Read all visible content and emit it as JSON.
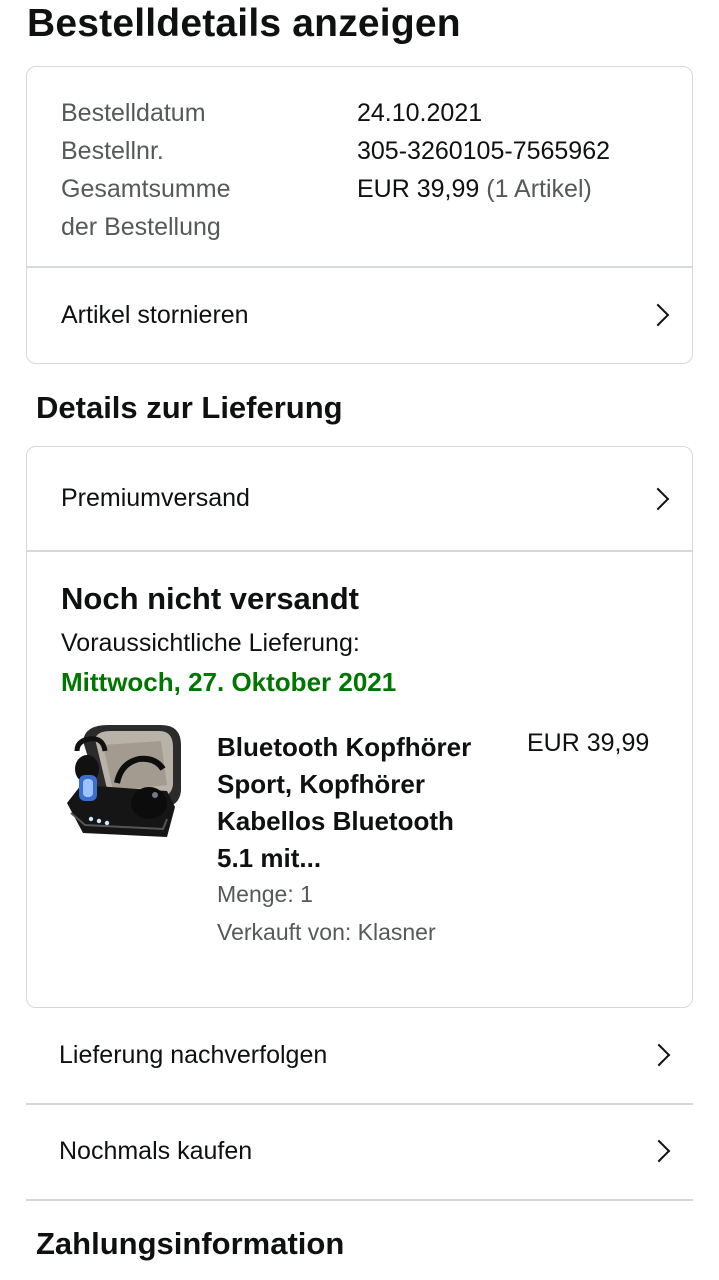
{
  "page": {
    "title": "Bestelldetails anzeigen"
  },
  "order_summary": {
    "date_label": "Bestelldatum",
    "date_value": "24.10.2021",
    "number_label": "Bestellnr.",
    "number_value": "305-3260105-7565962",
    "total_label_line1": "Gesamtsumme",
    "total_label_line2": "der Bestellung",
    "total_value": "EUR 39,99",
    "total_items": "(1 Artikel)",
    "cancel_label": "Artikel stornieren"
  },
  "delivery": {
    "heading": "Details zur Lieferung",
    "shipping_method": "Premiumversand",
    "status": "Noch nicht versandt",
    "eta_label": "Voraussichtliche Lieferung:",
    "eta_date": "Mittwoch, 27. Oktober 2021",
    "eta_color": "#007600",
    "item": {
      "image_icon": "earbuds-product-image",
      "title_lines": [
        "Bluetooth Kopfhörer",
        "Sport, Kopfhörer",
        "Kabellos Bluetooth",
        "5.1 mit..."
      ],
      "price": "EUR 39,99",
      "quantity": "Menge: 1",
      "seller": "Verkauft von: Klasner"
    }
  },
  "actions": {
    "track": "Lieferung nachverfolgen",
    "buy_again": "Nochmals kaufen"
  },
  "payment": {
    "heading": "Zahlungsinformation"
  }
}
